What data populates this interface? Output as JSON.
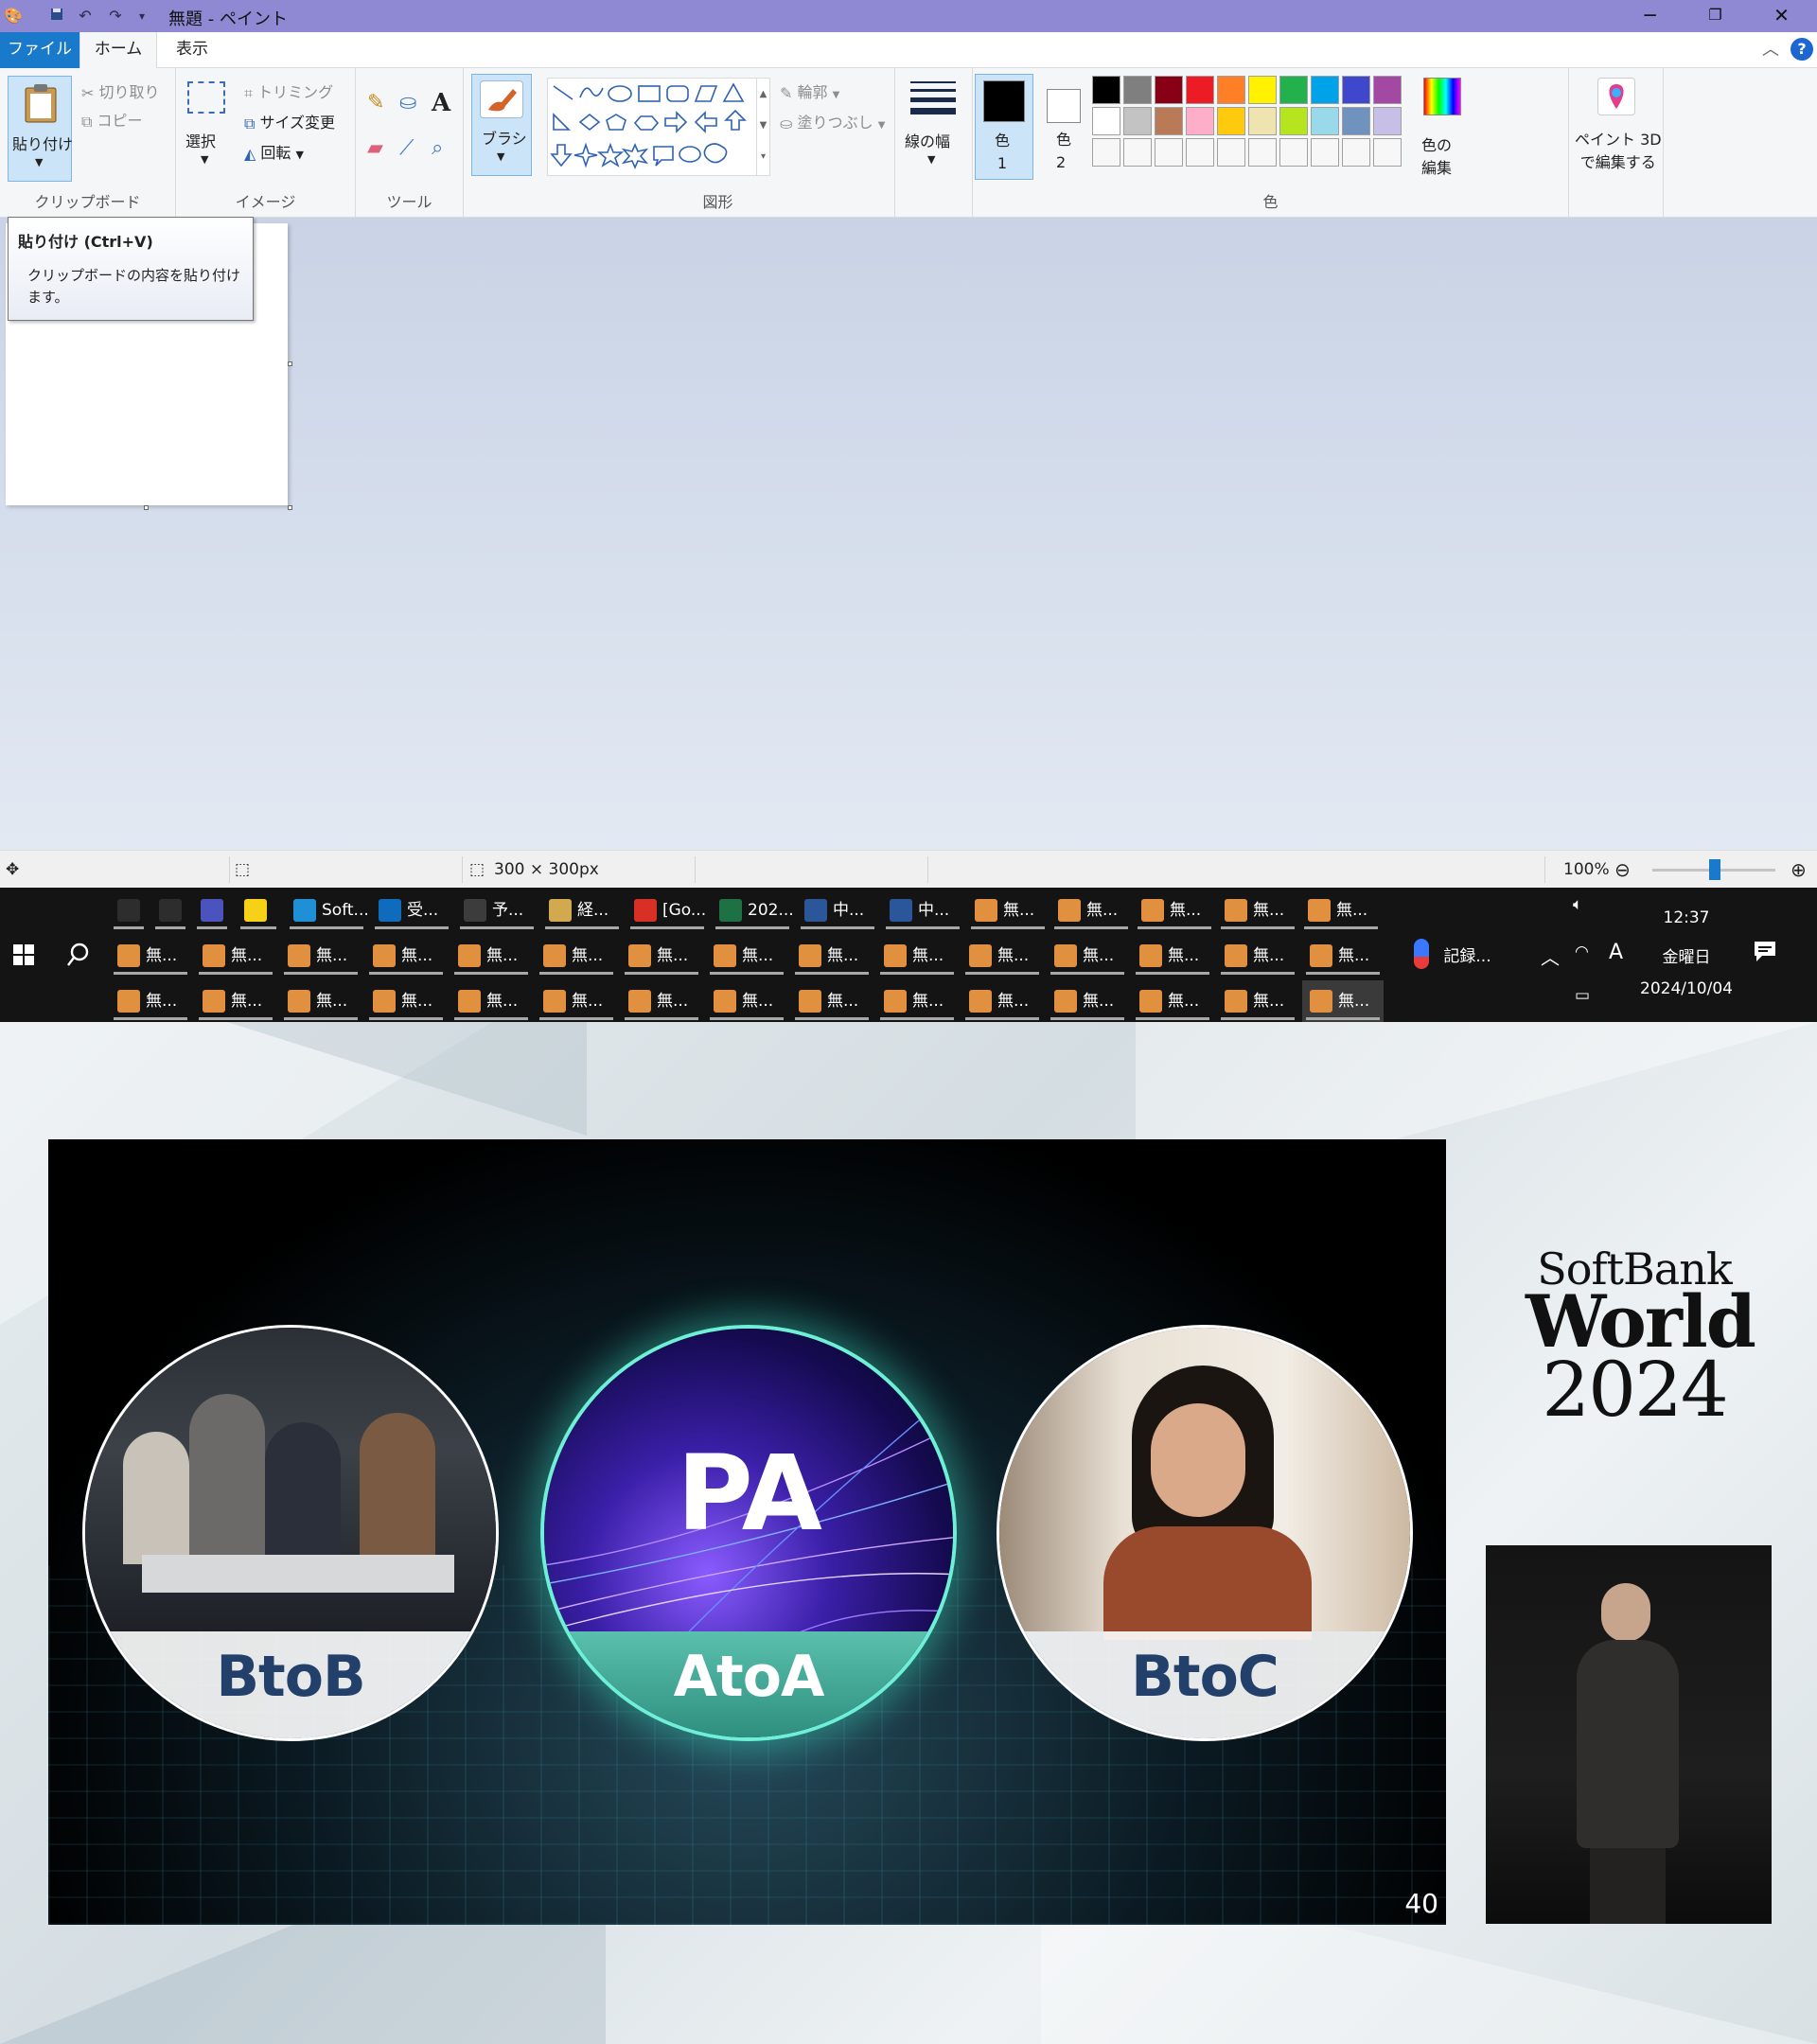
{
  "window": {
    "title": "無題 - ペイント",
    "controls": [
      "minimize",
      "restore",
      "close"
    ]
  },
  "tabs": {
    "file": "ファイル",
    "home": "ホーム",
    "view": "表示"
  },
  "ribbon": {
    "clipboard": {
      "group": "クリップボード",
      "paste": "貼り付け",
      "cut": "切り取り",
      "copy": "コピー"
    },
    "image": {
      "group": "イメージ",
      "select": "選択",
      "crop": "トリミング",
      "resize": "サイズ変更",
      "rotate": "回転"
    },
    "tools": {
      "group": "ツール"
    },
    "brushes": {
      "label": "ブラシ"
    },
    "shapes": {
      "group": "図形",
      "outline": "輪郭",
      "fill": "塗りつぶし"
    },
    "size": {
      "label": "線の幅"
    },
    "colors": {
      "group": "色",
      "color1": "色\n1",
      "color2": "色\n2",
      "edit": "色の\n編集",
      "palette_row1": [
        "#000000",
        "#7f7f7f",
        "#880015",
        "#ed1c24",
        "#ff7f27",
        "#fff200",
        "#22b14c",
        "#00a2e8",
        "#3f48cc",
        "#a349a4"
      ],
      "palette_row2": [
        "#ffffff",
        "#c3c3c3",
        "#b97a57",
        "#ffaec9",
        "#ffc90e",
        "#efe4b0",
        "#b5e61d",
        "#99d9ea",
        "#7092be",
        "#c8bfe7"
      ]
    },
    "paint3d": "ペイント 3D\nで編集する"
  },
  "tooltip": {
    "title": "貼り付け (Ctrl+V)",
    "desc": "クリップボードの内容を貼り付けます。"
  },
  "statusbar": {
    "size": "300 × 300px",
    "zoom": "100%"
  },
  "taskbar": {
    "row1": [
      "",
      "",
      "",
      "",
      "Soft...",
      "受...",
      "予...",
      "経...",
      "[Go...",
      "202...",
      "中...",
      "中...",
      "無...",
      "無...",
      "無...",
      "無...",
      "無..."
    ],
    "row2_label": "無...",
    "row3_label": "無...",
    "weather": "記録...",
    "time": "12:37",
    "day": "金曜日",
    "date": "2024/10/04",
    "ime": "A"
  },
  "slide": {
    "left": "BtoB",
    "center_big": "PA",
    "center": "AtoA",
    "right": "BtoC",
    "page": "40"
  },
  "logo": {
    "line1": "SoftBank",
    "line2": "World",
    "line3": "2024"
  }
}
